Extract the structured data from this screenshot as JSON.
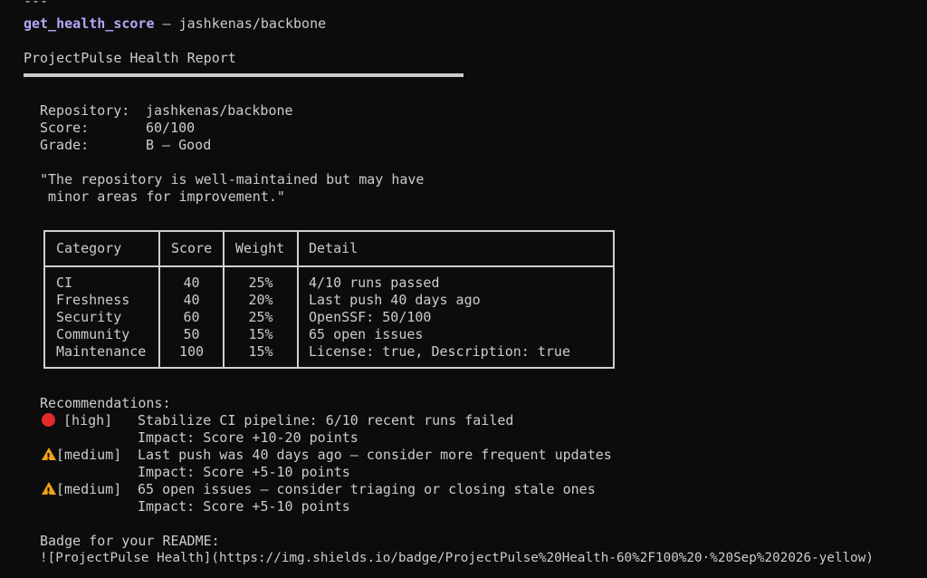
{
  "header": {
    "dashes": "---",
    "command": "get_health_score",
    "separator": " — ",
    "repo_arg": "jashkenas/backbone",
    "report_title": "ProjectPulse Health Report"
  },
  "summary": {
    "repository_label": "Repository:",
    "repository_value": "jashkenas/backbone",
    "score_label": "Score:",
    "score_value": "60/100",
    "grade_label": "Grade:",
    "grade_value": "B — Good",
    "quote_line1": "\"The repository is well-maintained but may have",
    "quote_line2": " minor areas for improvement.\""
  },
  "table": {
    "headers": [
      "Category",
      "Score",
      "Weight",
      "Detail"
    ],
    "rows": [
      {
        "category": "CI",
        "score": "40",
        "weight": "25%",
        "detail": "4/10 runs passed"
      },
      {
        "category": "Freshness",
        "score": "40",
        "weight": "20%",
        "detail": "Last push 40 days ago"
      },
      {
        "category": "Security",
        "score": "60",
        "weight": "25%",
        "detail": "OpenSSF: 50/100"
      },
      {
        "category": "Community",
        "score": "50",
        "weight": "15%",
        "detail": "65 open issues"
      },
      {
        "category": "Maintenance",
        "score": "100",
        "weight": "15%",
        "detail": "License: true, Description: true"
      }
    ]
  },
  "recommendations": {
    "title": "Recommendations:",
    "items": [
      {
        "icon": "red-circle-icon",
        "level": " [high]",
        "text": "Stabilize CI pipeline: 6/10 recent runs failed",
        "impact": "Impact: Score +10-20 points"
      },
      {
        "icon": "warning-icon",
        "level": "[medium]",
        "text": "Last push was 40 days ago — consider more frequent updates",
        "impact": "Impact: Score +5-10 points"
      },
      {
        "icon": "warning-icon",
        "level": "[medium]",
        "text": "65 open issues — consider triaging or closing stale ones",
        "impact": "Impact: Score +5-10 points"
      }
    ]
  },
  "badge": {
    "title": "Badge for your README:",
    "markdown": "![ProjectPulse Health](https://img.shields.io/badge/ProjectPulse%20Health-60%2F100%20·%20Sep%202026-yellow)"
  },
  "colors": {
    "background": "#0c0c0c",
    "text": "#cccccc",
    "command": "#b4a7f7",
    "high": "#e22a2a",
    "medium": "#f0a21a"
  }
}
